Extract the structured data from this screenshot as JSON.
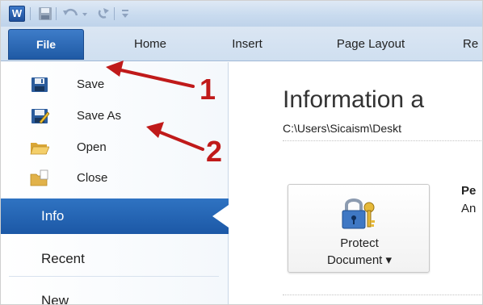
{
  "app": {
    "logo_letter": "W"
  },
  "quick_access": {
    "icons": [
      "word-icon",
      "save-icon",
      "undo-icon",
      "redo-icon",
      "customize-icon"
    ]
  },
  "tabs": {
    "file": "File",
    "home": "Home",
    "insert": "Insert",
    "page_layout": "Page Layout",
    "references": "Re"
  },
  "backstage": {
    "commands": {
      "save": "Save",
      "save_as": "Save As",
      "open": "Open",
      "close": "Close"
    },
    "nav": {
      "info": "Info",
      "recent": "Recent",
      "new": "New"
    },
    "selected": "Info"
  },
  "info": {
    "title": "Information a",
    "path": "C:\\Users\\Sicaism\\Deskt",
    "protect_line1": "Protect",
    "protect_line2": "Document ▾",
    "permissions_title": "Pe",
    "permissions_desc": "An"
  },
  "annotations": {
    "number_1": "1",
    "number_2": "2",
    "color": "#c01a1a"
  },
  "colors": {
    "accent": "#1f5aa5",
    "file_tab": "#2f6fbf",
    "ribbon_bg": "#d6e3f2"
  }
}
